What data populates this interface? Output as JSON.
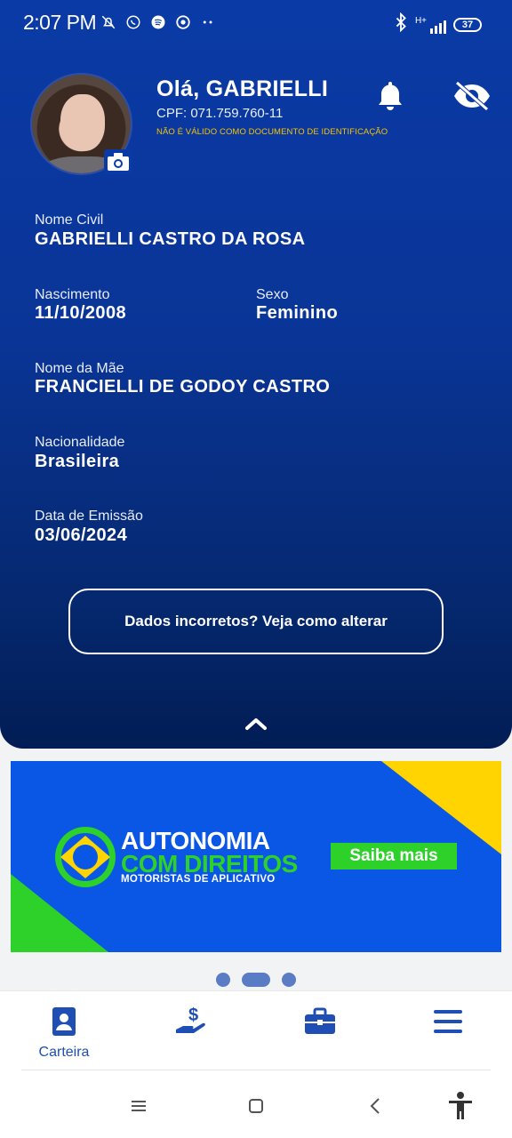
{
  "status_bar": {
    "time": "2:07 PM",
    "left_icons": [
      "mute-icon",
      "whatsapp-icon",
      "spotify-icon",
      "chrome-icon",
      "more-dots-icon"
    ],
    "network": "H+",
    "battery": "37"
  },
  "header": {
    "greeting": "Olá, GABRIELLI",
    "cpf": "CPF: 071.759.760-11",
    "warning": "NÃO É VÁLIDO COMO DOCUMENTO DE IDENTIFICAÇÃO"
  },
  "fields": {
    "nome_civil": {
      "label": "Nome Civil",
      "value": "GABRIELLI CASTRO DA ROSA"
    },
    "nascimento": {
      "label": "Nascimento",
      "value": "11/10/2008"
    },
    "sexo": {
      "label": "Sexo",
      "value": "Feminino"
    },
    "nome_mae": {
      "label": "Nome da Mãe",
      "value": "FRANCIELLI DE GODOY CASTRO"
    },
    "nacionalidade": {
      "label": "Nacionalidade",
      "value": "Brasileira"
    },
    "data_emissao": {
      "label": "Data de Emissão",
      "value": "03/06/2024"
    }
  },
  "change_button": "Dados incorretos? Veja como alterar",
  "banner": {
    "title_line1": "AUTONOMIA",
    "title_line2": "COM DIREITOS",
    "subtitle": "MOTORISTAS DE APLICATIVO",
    "cta": "Saiba mais"
  },
  "pager": {
    "count": 3,
    "active": 1
  },
  "bottom_nav": {
    "items": [
      {
        "icon": "id-card-icon",
        "label": "Carteira",
        "active": true
      },
      {
        "icon": "payment-hand-icon",
        "label": ""
      },
      {
        "icon": "briefcase-icon",
        "label": ""
      },
      {
        "icon": "menu-icon",
        "label": ""
      }
    ]
  },
  "colors": {
    "primary": "#0a3aa6",
    "accent_yellow": "#f5c400",
    "accent_green": "#2ed12a",
    "nav_blue": "#1f4fb4"
  }
}
